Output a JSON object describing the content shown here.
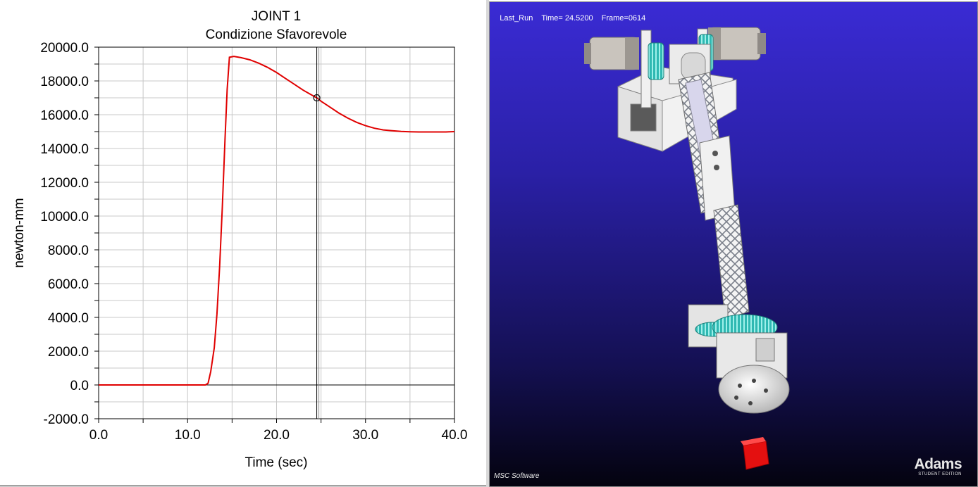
{
  "plot": {
    "title": "JOINT 1",
    "subtitle": "Condizione Sfavorevole",
    "xlabel": "Time (sec)",
    "ylabel": "newton-mm",
    "cursor_time": 24.52
  },
  "chart_data": {
    "type": "line",
    "title": "JOINT 1",
    "subtitle": "Condizione Sfavorevole",
    "xlabel": "Time (sec)",
    "ylabel": "newton-mm",
    "xlim": [
      0.0,
      40.0
    ],
    "ylim": [
      -2000.0,
      20000.0
    ],
    "x_ticks": [
      "0.0",
      "10.0",
      "20.0",
      "30.0",
      "40.0"
    ],
    "y_ticks": [
      "-2000.0",
      "0.0",
      "2000.0",
      "4000.0",
      "6000.0",
      "8000.0",
      "10000.0",
      "12000.0",
      "14000.0",
      "16000.0",
      "18000.0",
      "20000.0"
    ],
    "grid": true,
    "series": [
      {
        "color": "#e00000",
        "x": [
          0,
          12.0,
          12.3,
          12.6,
          13.0,
          13.3,
          13.6,
          13.9,
          14.2,
          14.45,
          14.7,
          15.2,
          16,
          17,
          18,
          19,
          20,
          21,
          22,
          23,
          24,
          24.52,
          25,
          26,
          27,
          28,
          29,
          30,
          31,
          32,
          33,
          34,
          35,
          36,
          37,
          38,
          39,
          40
        ],
        "y": [
          0,
          0,
          100,
          800,
          2200,
          4200,
          7000,
          10500,
          14500,
          17500,
          19400,
          19450,
          19380,
          19250,
          19050,
          18800,
          18500,
          18150,
          17800,
          17450,
          17150,
          17000,
          16800,
          16450,
          16100,
          15800,
          15550,
          15350,
          15200,
          15100,
          15050,
          15010,
          14990,
          14980,
          14980,
          14980,
          14980,
          15000
        ]
      }
    ]
  },
  "viewport": {
    "run_name": "Last_Run",
    "time_text": "Time= 24.5200",
    "frame_text": "Frame=0614",
    "msc_logo": "MSC Software",
    "adams_logo": "Adams",
    "adams_edition": "STUDENT EDITION"
  },
  "colors": {
    "background_top": "#3a2bd4",
    "background_bottom": "#04030f",
    "model_white": "#f2f2f2",
    "gear_teal": "#37c8c0",
    "marker_red": "#e41010"
  }
}
